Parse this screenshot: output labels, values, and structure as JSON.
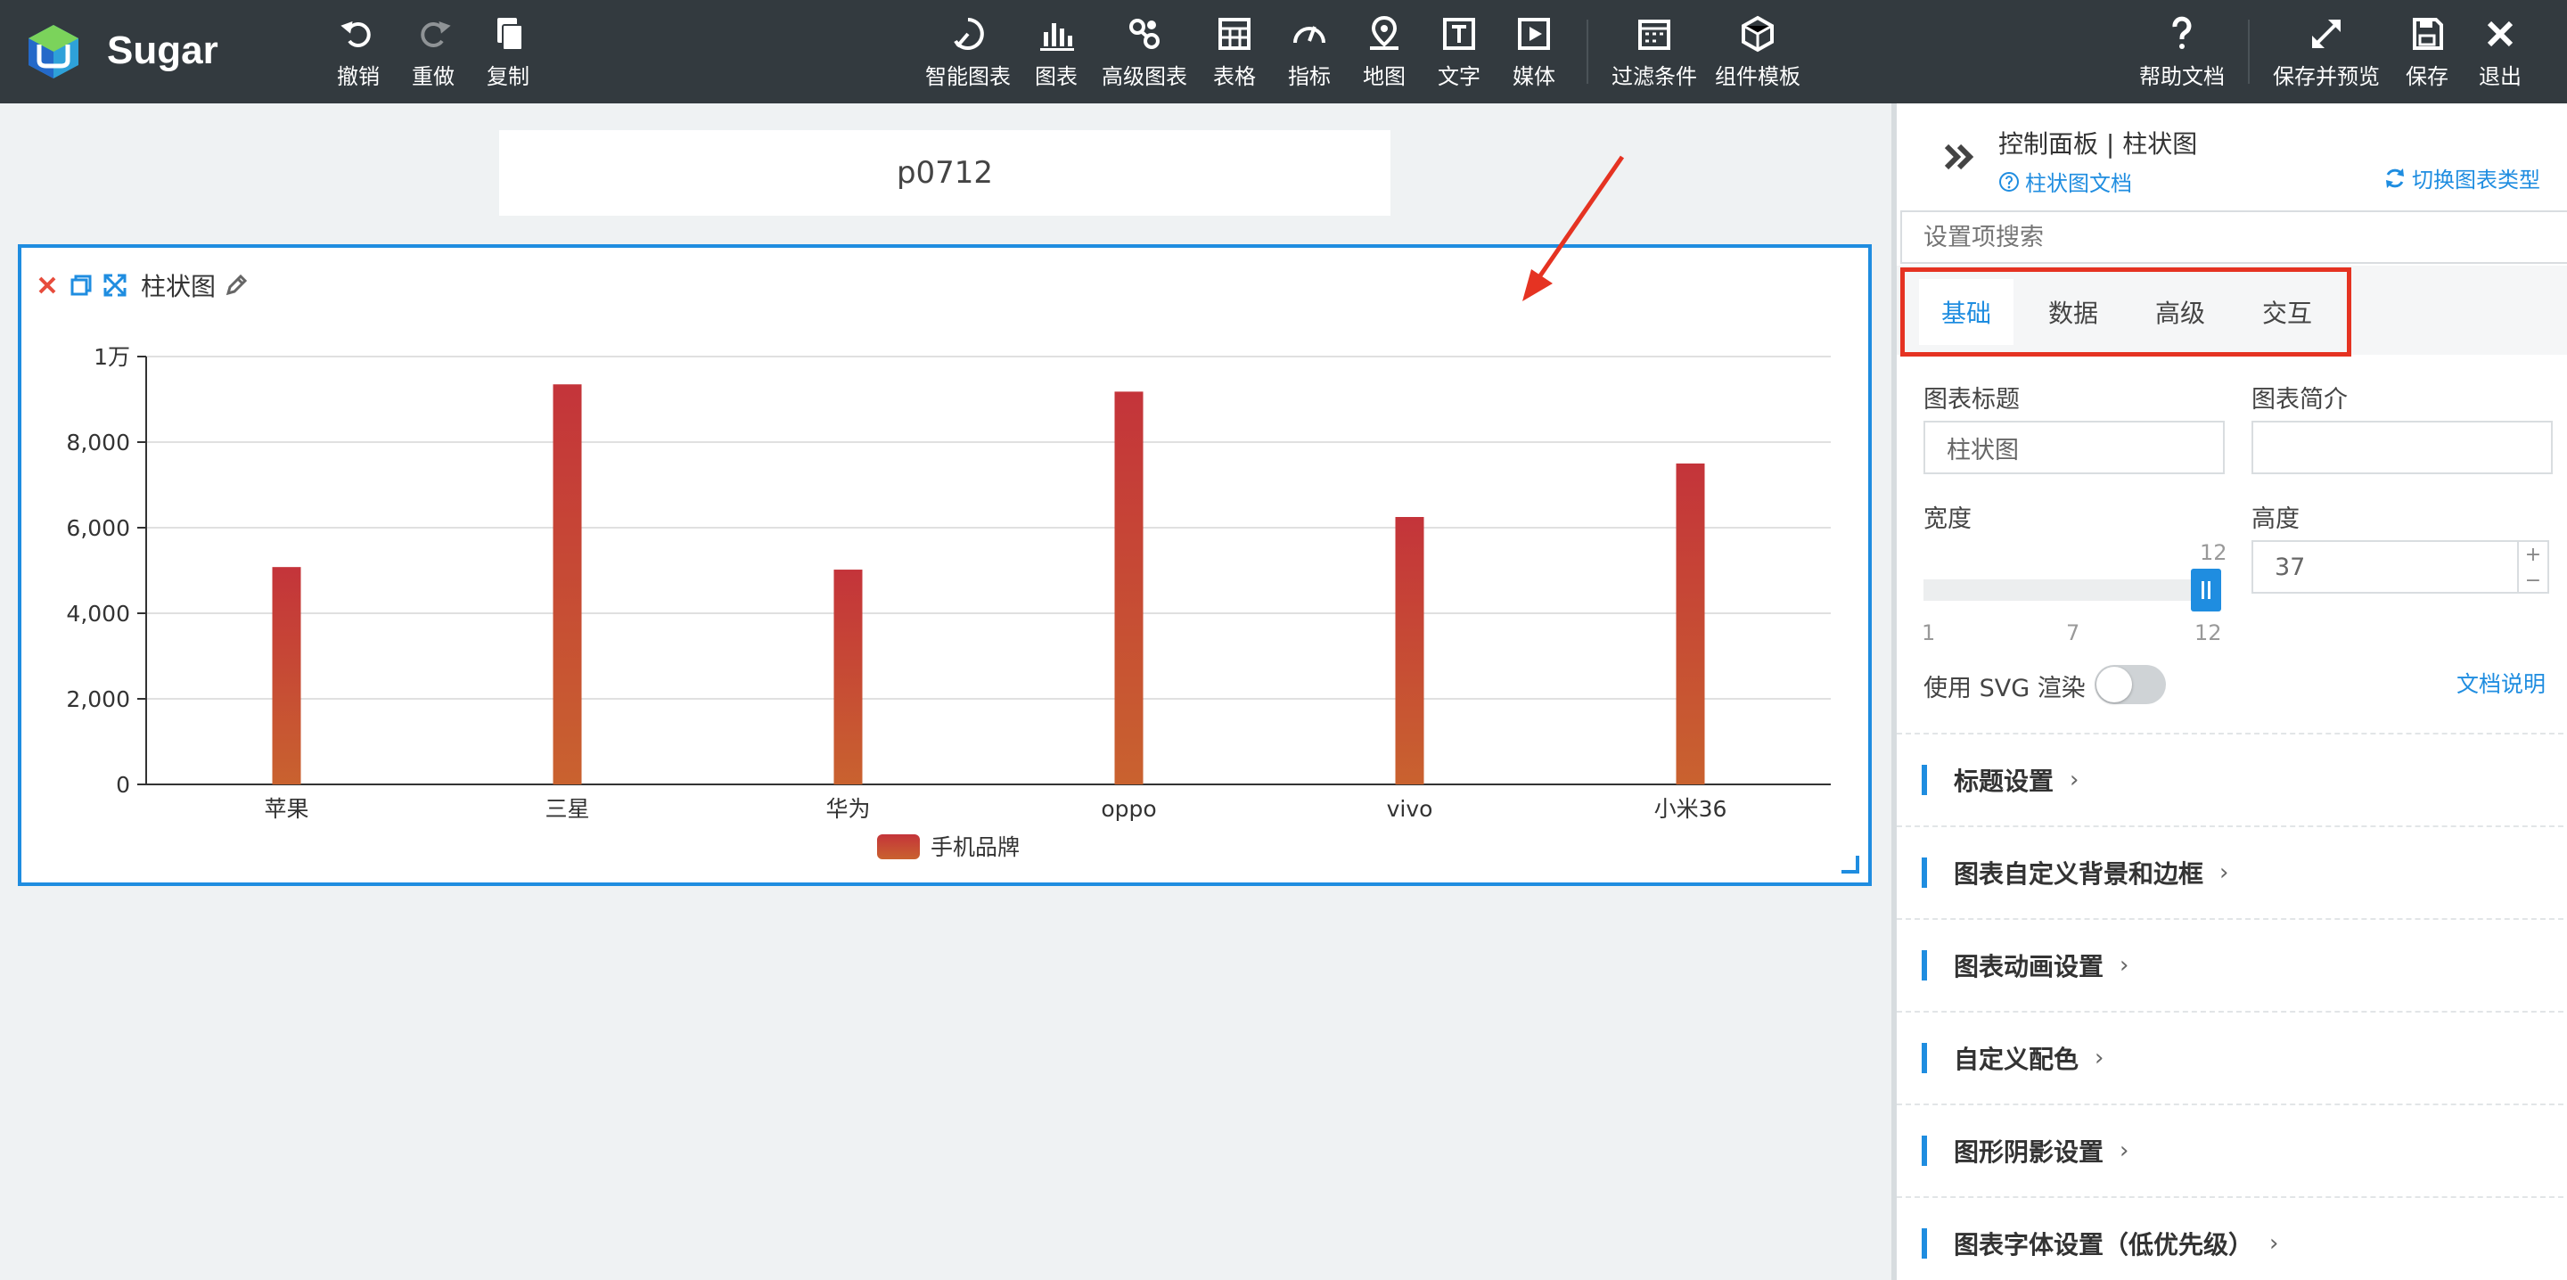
{
  "app": {
    "brand": "Sugar"
  },
  "toolbar": {
    "left": [
      {
        "label": "撤销",
        "icon": "undo-icon"
      },
      {
        "label": "重做",
        "icon": "redo-icon"
      },
      {
        "label": "复制",
        "icon": "copy-icon"
      }
    ],
    "center": [
      {
        "label": "智能图表",
        "icon": "smart-chart-icon"
      },
      {
        "label": "图表",
        "icon": "bar-chart-icon"
      },
      {
        "label": "高级图表",
        "icon": "advanced-chart-icon"
      },
      {
        "label": "表格",
        "icon": "table-icon"
      },
      {
        "label": "指标",
        "icon": "gauge-icon"
      },
      {
        "label": "地图",
        "icon": "map-pin-icon"
      },
      {
        "label": "文字",
        "icon": "text-icon"
      },
      {
        "label": "媒体",
        "icon": "media-icon"
      },
      {
        "label": "过滤条件",
        "icon": "filter-icon"
      },
      {
        "label": "组件模板",
        "icon": "template-icon"
      }
    ],
    "right": [
      {
        "label": "帮助文档",
        "icon": "help-icon"
      },
      {
        "label": "保存并预览",
        "icon": "expand-icon"
      },
      {
        "label": "保存",
        "icon": "save-icon"
      },
      {
        "label": "退出",
        "icon": "close-icon"
      }
    ]
  },
  "canvas": {
    "page_title": "p0712",
    "chart_card_title": "柱状图"
  },
  "chart_data": {
    "type": "bar",
    "categories": [
      "苹果",
      "三星",
      "华为",
      "oppo",
      "vivo",
      "小米36"
    ],
    "series": [
      {
        "name": "手机品牌",
        "values": [
          5080,
          9350,
          5020,
          9180,
          6250,
          7500
        ]
      }
    ],
    "ylim": [
      0,
      10000
    ],
    "yticks": [
      "0",
      "2,000",
      "4,000",
      "6,000",
      "8,000",
      "1万"
    ],
    "grid": true,
    "legend": "bottom",
    "bar_color_top": "#c4343a",
    "bar_color_bottom": "#c9622f"
  },
  "panel": {
    "title": "控制面板 | 柱状图",
    "doc_link": "柱状图文档",
    "switch_type": "切换图表类型",
    "search_placeholder": "设置项搜索",
    "tabs": [
      "基础",
      "数据",
      "高级",
      "交互"
    ],
    "active_tab": 0,
    "fields": {
      "chart_title_label": "图表标题",
      "chart_title_value": "柱状图",
      "chart_desc_label": "图表简介",
      "chart_desc_value": "",
      "width_label": "宽度",
      "width_value": "12",
      "width_min": "1",
      "width_mid": "7",
      "width_max": "12",
      "height_label": "高度",
      "height_value": "37",
      "svg_label": "使用 SVG 渲染",
      "svg_doc": "文档说明"
    },
    "sections": [
      "标题设置",
      "图表自定义背景和边框",
      "图表动画设置",
      "自定义配色",
      "图形阴影设置",
      "图表字体设置（低优先级）"
    ]
  },
  "colors": {
    "accent": "#1f8de0",
    "toolbar_bg": "#333a3f",
    "highlight_red": "#e53322"
  }
}
